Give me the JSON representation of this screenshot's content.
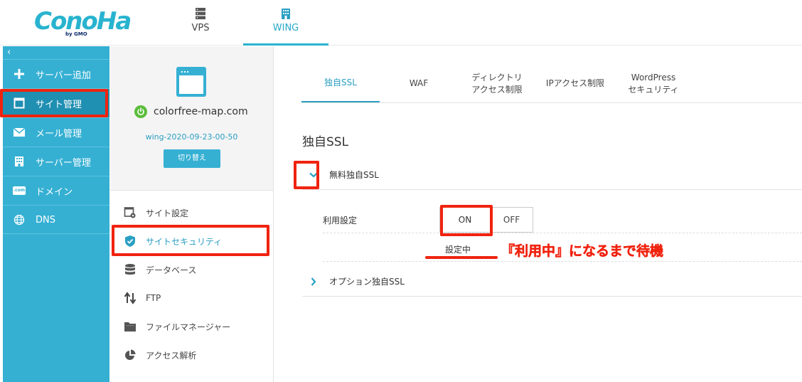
{
  "header": {
    "logo_text": "ConoHa",
    "logo_sub": "by GMO",
    "tabs": [
      {
        "label": "VPS",
        "icon": "server-icon"
      },
      {
        "label": "WING",
        "icon": "building-icon",
        "active": true
      }
    ]
  },
  "sidebar": {
    "collapse": "‹",
    "items": [
      {
        "label": "サーバー追加",
        "icon": "plus-icon"
      },
      {
        "label": "サイト管理",
        "icon": "window-icon",
        "active": true
      },
      {
        "label": "メール管理",
        "icon": "mail-icon"
      },
      {
        "label": "サーバー管理",
        "icon": "building-icon"
      },
      {
        "label": "ドメイン",
        "icon": "domain-icon",
        "icon_text": ".com"
      },
      {
        "label": "DNS",
        "icon": "globe-icon"
      }
    ]
  },
  "site": {
    "domain": "colorfree-map.com",
    "id": "wing-2020-09-23-00-50",
    "switch_label": "切り替え"
  },
  "submenu": [
    {
      "label": "サイト設定",
      "icon": "site-settings-icon"
    },
    {
      "label": "サイトセキュリティ",
      "icon": "shield-icon",
      "active": true
    },
    {
      "label": "データベース",
      "icon": "database-icon"
    },
    {
      "label": "FTP",
      "icon": "updown-arrows-icon"
    },
    {
      "label": "ファイルマネージャー",
      "icon": "folder-icon"
    },
    {
      "label": "アクセス解析",
      "icon": "pie-chart-icon"
    }
  ],
  "main": {
    "tabs": [
      {
        "line1": "独自SSL",
        "line2": "",
        "active": true
      },
      {
        "line1": "WAF",
        "line2": ""
      },
      {
        "line1": "ディレクトリ",
        "line2": "アクセス制限"
      },
      {
        "line1": "IPアクセス制限",
        "line2": ""
      },
      {
        "line1": "WordPress",
        "line2": "セキュリティ"
      }
    ],
    "section_title": "独自SSL",
    "accordion_free": {
      "label": "無料独自SSL",
      "chevron": "⌄"
    },
    "usage_label": "利用設定",
    "toggle": {
      "on": "ON",
      "off": "OFF",
      "selected": "ON"
    },
    "status": "設定中",
    "accordion_option": {
      "label": "オプション独自SSL",
      "chevron": "›"
    }
  },
  "annotation": {
    "text": "『利用中』になるまで待機",
    "color": "#f0230f"
  },
  "colors": {
    "accent": "#35b0d3",
    "accent_dark": "#2a9fc3",
    "power_green": "#5bbd3b",
    "highlight_red": "#f0230f"
  }
}
